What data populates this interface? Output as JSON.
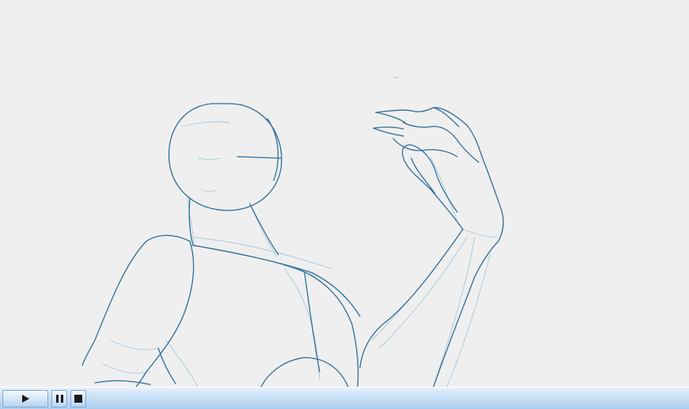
{
  "player": {
    "controls": {
      "play_icon": "play-icon",
      "pause_icon": "pause-icon",
      "stop_icon": "stop-icon"
    },
    "colors": {
      "background": "#efefef",
      "sketch_stroke": "#2f6f9a",
      "sketch_light": "#9bbfd6",
      "control_bar": "#c9e0f6"
    }
  }
}
